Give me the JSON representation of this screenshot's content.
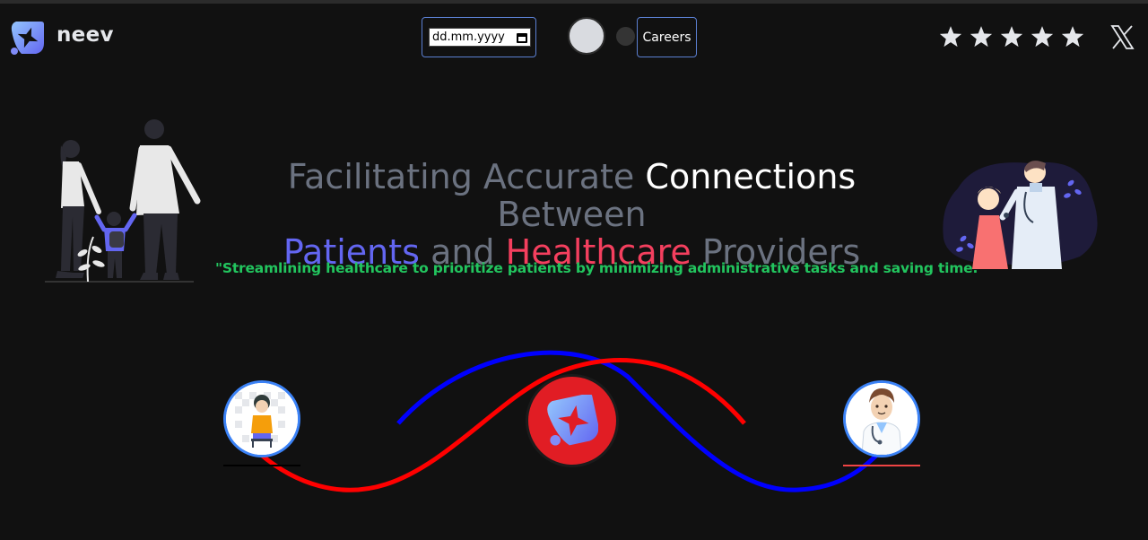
{
  "header": {
    "brand": "neev",
    "date_placeholder": "dd.mm.yyyy",
    "careers_label": "Careers",
    "rating_stars": 5,
    "social_icon": "x-icon"
  },
  "hero": {
    "headline": {
      "part1": "Facilitating Accurate",
      "part2": "Connections",
      "part3": "Between",
      "part4": "Patients",
      "part5": "and",
      "part6": "Healthcare",
      "part7": "Providers"
    },
    "tagline": "\"Streamlining healthcare to prioritize patients by minimizing administrative tasks and saving time.\""
  },
  "icons": [
    "neev-logo",
    "calendar-icon",
    "star-icon",
    "x-icon",
    "family-illustration",
    "doctor-illustration",
    "patient-avatar",
    "doctor-avatar",
    "neev-logo-badge"
  ],
  "colors": {
    "background": "#111111",
    "accent_blue": "#6366f1",
    "accent_red": "#f43f5e",
    "tagline_green": "#22c55e",
    "wave_blue": "#0000ff",
    "wave_red": "#ff0000",
    "badge_red": "#e11d24"
  }
}
